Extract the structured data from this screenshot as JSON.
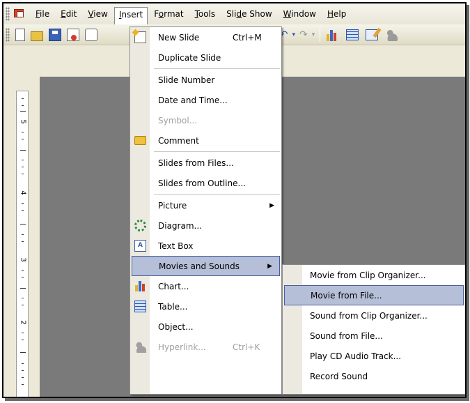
{
  "menubar": {
    "items": [
      {
        "label": "File",
        "key": "F"
      },
      {
        "label": "Edit",
        "key": "E"
      },
      {
        "label": "View",
        "key": "V"
      },
      {
        "label": "Insert",
        "key": "I"
      },
      {
        "label": "Format",
        "key": "o"
      },
      {
        "label": "Tools",
        "key": "T"
      },
      {
        "label": "Slide Show",
        "key": "d"
      },
      {
        "label": "Window",
        "key": "W"
      },
      {
        "label": "Help",
        "key": "H"
      }
    ]
  },
  "toolbar": {
    "icons": [
      "new-icon",
      "open-icon",
      "save-icon",
      "permission-icon",
      "attach-icon",
      "format-painter-icon",
      "undo-icon",
      "redo-icon",
      "chart-icon",
      "table-icon",
      "edit-icon",
      "people-icon"
    ]
  },
  "ruler": {
    "numbers": [
      "5",
      "4",
      "3",
      "2"
    ]
  },
  "insert_menu": {
    "items": [
      {
        "label": "New Slide",
        "shortcut": "Ctrl+M",
        "icon": "new-slide-icon"
      },
      {
        "label": "Duplicate Slide"
      },
      {
        "label": "Slide Number"
      },
      {
        "label": "Date and Time..."
      },
      {
        "label": "Symbol...",
        "disabled": true
      },
      {
        "label": "Comment",
        "icon": "comment-icon"
      },
      {
        "label": "Slides from Files..."
      },
      {
        "label": "Slides from Outline..."
      },
      {
        "label": "Picture",
        "submenu": true
      },
      {
        "label": "Diagram...",
        "icon": "diagram-icon"
      },
      {
        "label": "Text Box",
        "icon": "text-box-icon"
      },
      {
        "label": "Movies and Sounds",
        "submenu": true,
        "highlighted": true
      },
      {
        "label": "Chart...",
        "icon": "chart-icon"
      },
      {
        "label": "Table...",
        "icon": "table-icon"
      },
      {
        "label": "Object..."
      },
      {
        "label": "Hyperlink...",
        "shortcut": "Ctrl+K",
        "disabled": true,
        "icon": "hyperlink-icon"
      }
    ]
  },
  "movies_submenu": {
    "items": [
      {
        "label": "Movie from Clip Organizer..."
      },
      {
        "label": "Movie from File...",
        "highlighted": true
      },
      {
        "label": "Sound from Clip Organizer..."
      },
      {
        "label": "Sound from File..."
      },
      {
        "label": "Play CD Audio Track..."
      },
      {
        "label": "Record Sound"
      }
    ]
  },
  "colors": {
    "highlight_bg": "#b6bfd8",
    "highlight_border": "#4a5e9a",
    "workspace": "#7a7a7a",
    "menu_bg": "#ffffff"
  }
}
